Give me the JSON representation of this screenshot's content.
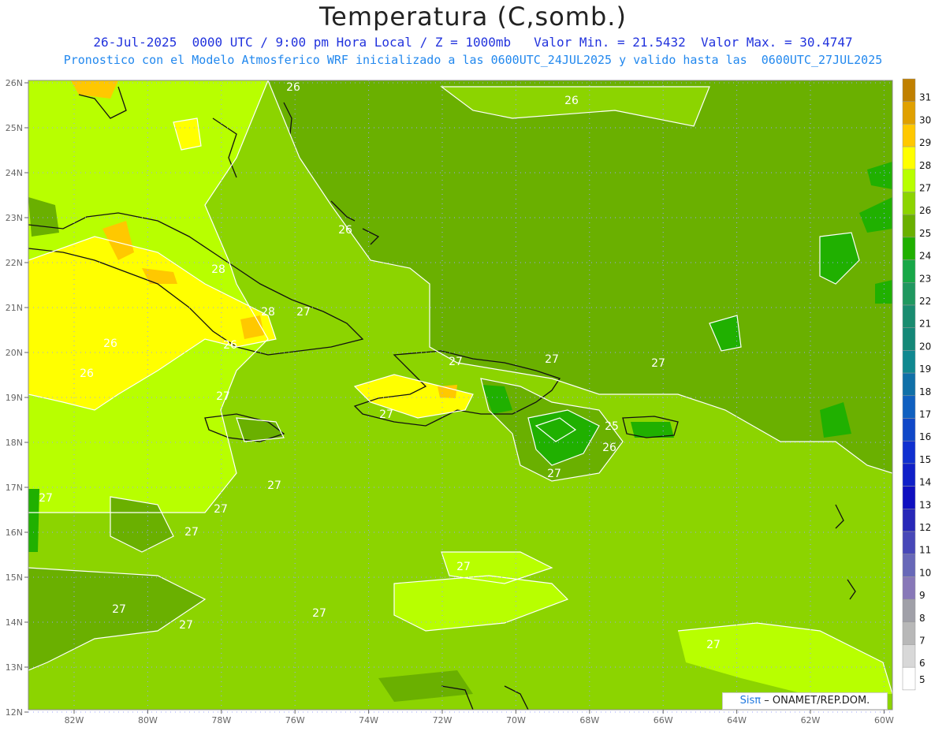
{
  "header": {
    "title": "Temperatura (C,somb.)",
    "line1": "26-Jul-2025  0000 UTC / 9:00 pm Hora Local / Z = 1000mb   Valor Min. = 21.5432  Valor Max. = 30.4747",
    "line2": "Pronostico con el Modelo Atmosferico WRF inicializado a las 0600UTC_24JUL2025 y valido hasta las  0600UTC_27JUL2025"
  },
  "axes": {
    "lat_labels": [
      "26N",
      "25N",
      "24N",
      "23N",
      "22N",
      "21N",
      "20N",
      "19N",
      "18N",
      "17N",
      "16N",
      "15N",
      "14N",
      "13N",
      "12N"
    ],
    "lon_labels": [
      "82W",
      "80W",
      "78W",
      "76W",
      "74W",
      "72W",
      "70W",
      "68W",
      "66W",
      "64W",
      "62W",
      "60W"
    ]
  },
  "colorbar": {
    "labels": [
      "31",
      "30",
      "29",
      "28",
      "27",
      "26",
      "25",
      "24",
      "23",
      "22",
      "21",
      "20",
      "19",
      "18",
      "17",
      "16",
      "15",
      "14",
      "13",
      "12",
      "11",
      "10",
      "9",
      "8",
      "7",
      "6",
      "5"
    ],
    "colors": [
      "#c08000",
      "#e0a000",
      "#ffc800",
      "#ffff00",
      "#b8ff00",
      "#8cd400",
      "#6ab000",
      "#20b000",
      "#18a848",
      "#209860",
      "#1a8c70",
      "#158878",
      "#108890",
      "#1070a8",
      "#1060c0",
      "#1048c8",
      "#1030d0",
      "#1020c8",
      "#1010c0",
      "#2828b8",
      "#4848b8",
      "#6868b8",
      "#8878b8",
      "#a0a0a8",
      "#b8b8b8",
      "#d8d8d8",
      "#ffffff"
    ]
  },
  "contour_labels": [
    "26",
    "26",
    "26",
    "27",
    "27",
    "27",
    "28",
    "28",
    "27",
    "26",
    "26",
    "26",
    "25",
    "26",
    "27",
    "27",
    "27",
    "27",
    "27",
    "27",
    "27",
    "27",
    "27",
    "27",
    "27",
    "27"
  ],
  "credit": {
    "sis": "Sisπ",
    "org": "– ONAMET/REP.DOM."
  }
}
